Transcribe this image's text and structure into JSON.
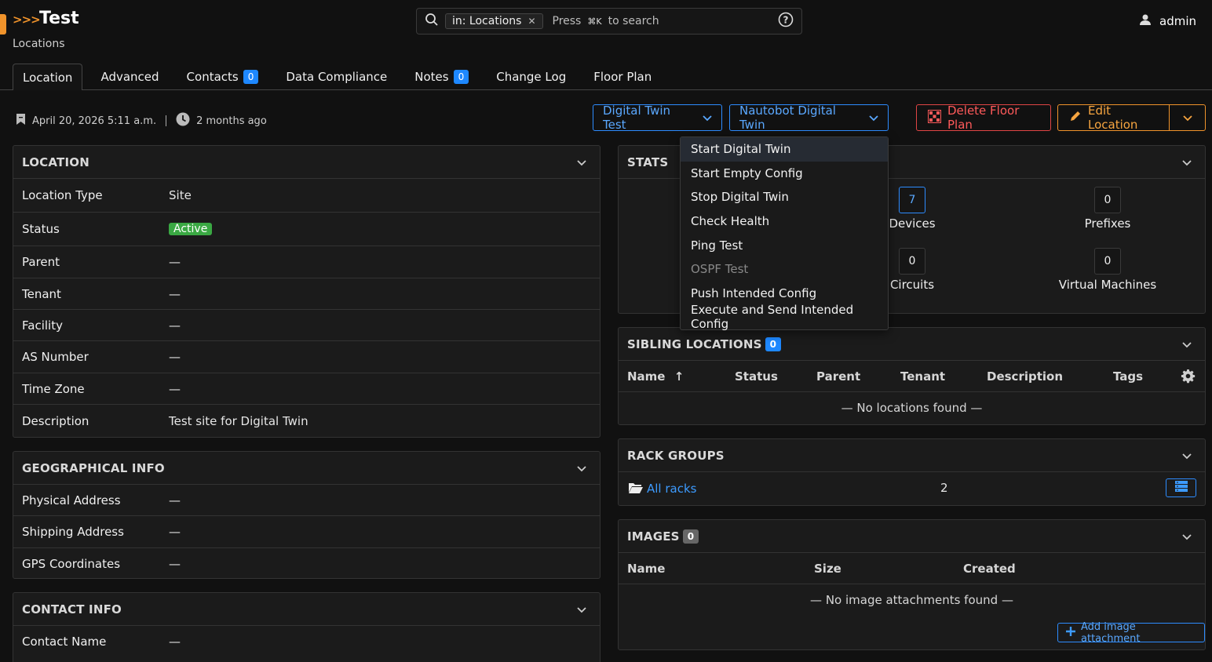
{
  "header": {
    "title": "Test",
    "breadcrumb": "Locations",
    "logo_glyph": ">>>",
    "accent_color": "#f0932b"
  },
  "search": {
    "scope_pill": "in: Locations",
    "hint_press": "Press",
    "hint_key": "⌘K",
    "hint_rest": "to search"
  },
  "user": {
    "name": "admin"
  },
  "tabs": [
    {
      "label": "Location",
      "active": true
    },
    {
      "label": "Advanced"
    },
    {
      "label": "Contacts",
      "badge": "0"
    },
    {
      "label": "Data Compliance"
    },
    {
      "label": "Notes",
      "badge": "0"
    },
    {
      "label": "Change Log"
    },
    {
      "label": "Floor Plan"
    }
  ],
  "meta": {
    "created": "April 20, 2026 5:11 a.m.",
    "updated": "2 months ago"
  },
  "actions": {
    "digital_twin_test": "Digital Twin Test",
    "nautobot_digital_twin": "Nautobot Digital Twin",
    "delete_floor_plan": "Delete Floor Plan",
    "edit_location": "Edit Location"
  },
  "dropdown": {
    "items": [
      {
        "label": "Start Digital Twin",
        "state": "hover"
      },
      {
        "label": "Start Empty Config"
      },
      {
        "label": "Stop Digital Twin"
      },
      {
        "label": "Check Health"
      },
      {
        "label": "Ping Test"
      },
      {
        "label": "OSPF Test",
        "state": "disabled"
      },
      {
        "label": "Push Intended Config"
      },
      {
        "label": "Execute and Send Intended Config"
      }
    ]
  },
  "location_panel": {
    "title": "LOCATION",
    "rows": [
      {
        "key": "Location Type",
        "value": "Site"
      },
      {
        "key": "Status",
        "value": "Active"
      },
      {
        "key": "Parent",
        "value": "—"
      },
      {
        "key": "Tenant",
        "value": "—"
      },
      {
        "key": "Facility",
        "value": "—"
      },
      {
        "key": "AS Number",
        "value": "—"
      },
      {
        "key": "Time Zone",
        "value": "—"
      },
      {
        "key": "Description",
        "value": "Test site for Digital Twin"
      }
    ]
  },
  "geo_panel": {
    "title": "GEOGRAPHICAL INFO",
    "rows": [
      {
        "key": "Physical Address",
        "value": "—"
      },
      {
        "key": "Shipping Address",
        "value": "—"
      },
      {
        "key": "GPS Coordinates",
        "value": "—"
      }
    ]
  },
  "contact_panel": {
    "title": "CONTACT INFO",
    "rows": [
      {
        "key": "Contact Name",
        "value": "—"
      }
    ]
  },
  "stats_panel": {
    "title": "STATS",
    "items": [
      {
        "label": "Devices",
        "value": "7"
      },
      {
        "label": "Prefixes",
        "value": "0"
      },
      {
        "label": "Circuits",
        "value": "0"
      },
      {
        "label": "Virtual Machines",
        "value": "0"
      }
    ]
  },
  "sibling_panel": {
    "title": "SIBLING LOCATIONS",
    "badge": "0",
    "columns": [
      "Name",
      "Status",
      "Parent",
      "Tenant",
      "Description",
      "Tags"
    ],
    "empty": "— No locations found —"
  },
  "rack_panel": {
    "title": "RACK GROUPS",
    "link": "All racks",
    "count": "2"
  },
  "images_panel": {
    "title": "IMAGES",
    "badge": "0",
    "columns": [
      "Name",
      "Size",
      "Created"
    ],
    "empty": "— No image attachments found —",
    "add_button": "Add image attachment"
  }
}
